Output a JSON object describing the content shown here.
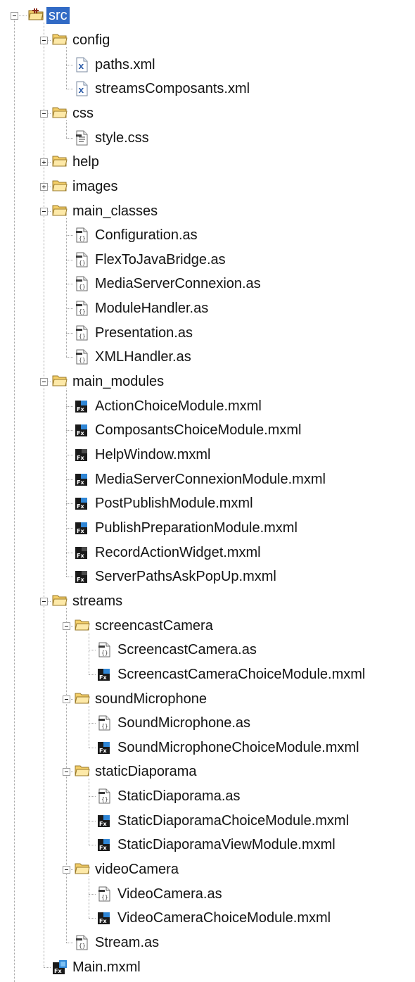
{
  "tree": {
    "nodes": [
      {
        "label": "src",
        "type": "source-folder",
        "depth": 0,
        "expanded": true,
        "selected": true
      },
      {
        "label": "config",
        "type": "folder",
        "depth": 1,
        "expanded": true
      },
      {
        "label": "paths.xml",
        "type": "xml-file",
        "depth": 2
      },
      {
        "label": "streamsComposants.xml",
        "type": "xml-file",
        "depth": 2
      },
      {
        "label": "css",
        "type": "folder",
        "depth": 1,
        "expanded": true
      },
      {
        "label": "style.css",
        "type": "css-file",
        "depth": 2
      },
      {
        "label": "help",
        "type": "folder",
        "depth": 1,
        "expanded": false
      },
      {
        "label": "images",
        "type": "folder",
        "depth": 1,
        "expanded": false
      },
      {
        "label": "main_classes",
        "type": "folder",
        "depth": 1,
        "expanded": true
      },
      {
        "label": "Configuration.as",
        "type": "as-file",
        "depth": 2
      },
      {
        "label": "FlexToJavaBridge.as",
        "type": "as-file",
        "depth": 2
      },
      {
        "label": "MediaServerConnexion.as",
        "type": "as-file",
        "depth": 2
      },
      {
        "label": "ModuleHandler.as",
        "type": "as-file",
        "depth": 2
      },
      {
        "label": "Presentation.as",
        "type": "as-file",
        "depth": 2
      },
      {
        "label": "XMLHandler.as",
        "type": "as-file",
        "depth": 2
      },
      {
        "label": "main_modules",
        "type": "folder",
        "depth": 1,
        "expanded": true
      },
      {
        "label": "ActionChoiceModule.mxml",
        "type": "mxml-module",
        "depth": 2
      },
      {
        "label": "ComposantsChoiceModule.mxml",
        "type": "mxml-module",
        "depth": 2
      },
      {
        "label": "HelpWindow.mxml",
        "type": "mxml-file",
        "depth": 2
      },
      {
        "label": "MediaServerConnexionModule.mxml",
        "type": "mxml-module",
        "depth": 2
      },
      {
        "label": "PostPublishModule.mxml",
        "type": "mxml-module",
        "depth": 2
      },
      {
        "label": "PublishPreparationModule.mxml",
        "type": "mxml-module",
        "depth": 2
      },
      {
        "label": "RecordActionWidget.mxml",
        "type": "mxml-file",
        "depth": 2
      },
      {
        "label": "ServerPathsAskPopUp.mxml",
        "type": "mxml-file",
        "depth": 2
      },
      {
        "label": "streams",
        "type": "folder",
        "depth": 1,
        "expanded": true
      },
      {
        "label": "screencastCamera",
        "type": "folder",
        "depth": 2,
        "expanded": true
      },
      {
        "label": "ScreencastCamera.as",
        "type": "as-file",
        "depth": 3
      },
      {
        "label": "ScreencastCameraChoiceModule.mxml",
        "type": "mxml-module",
        "depth": 3
      },
      {
        "label": "soundMicrophone",
        "type": "folder",
        "depth": 2,
        "expanded": true
      },
      {
        "label": "SoundMicrophone.as",
        "type": "as-file",
        "depth": 3
      },
      {
        "label": "SoundMicrophoneChoiceModule.mxml",
        "type": "mxml-module",
        "depth": 3
      },
      {
        "label": "staticDiaporama",
        "type": "folder",
        "depth": 2,
        "expanded": true
      },
      {
        "label": "StaticDiaporama.as",
        "type": "as-file",
        "depth": 3
      },
      {
        "label": "StaticDiaporamaChoiceModule.mxml",
        "type": "mxml-module",
        "depth": 3
      },
      {
        "label": "StaticDiaporamaViewModule.mxml",
        "type": "mxml-module",
        "depth": 3
      },
      {
        "label": "videoCamera",
        "type": "folder",
        "depth": 2,
        "expanded": true
      },
      {
        "label": "VideoCamera.as",
        "type": "as-file",
        "depth": 3
      },
      {
        "label": "VideoCameraChoiceModule.mxml",
        "type": "mxml-module",
        "depth": 3
      },
      {
        "label": "Stream.as",
        "type": "as-file",
        "depth": 2
      },
      {
        "label": "Main.mxml",
        "type": "mxml-application",
        "depth": 1
      }
    ]
  },
  "colors": {
    "selection_background": "#316ac5",
    "selection_text": "#ffffff",
    "folder": "#f4cf6a",
    "connector": "#a6a6a6",
    "module_accent": "#2f86d6"
  }
}
